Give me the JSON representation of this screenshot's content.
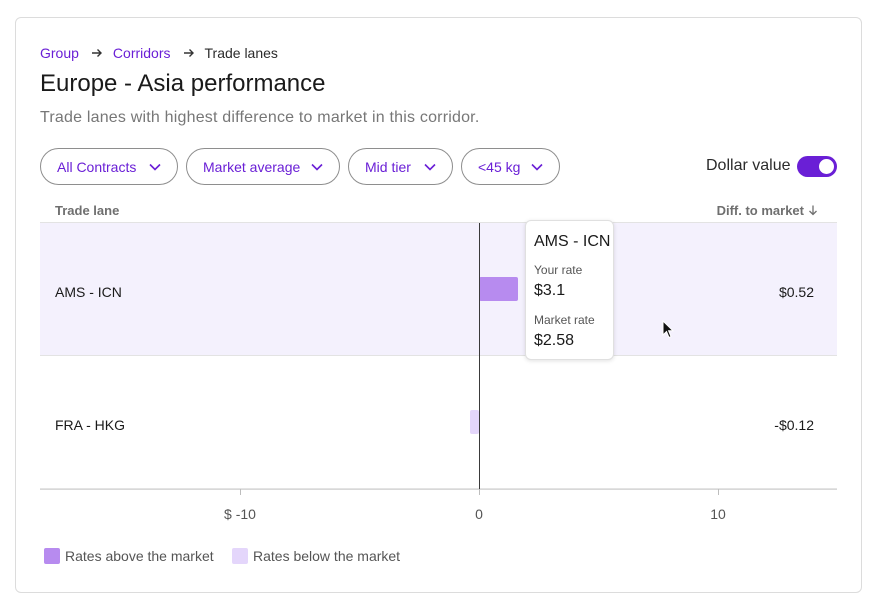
{
  "breadcrumb": {
    "items": [
      "Group",
      "Corridors"
    ],
    "current": "Trade lanes"
  },
  "title": "Europe - Asia performance",
  "subtitle": "Trade lanes with highest difference to market in this corridor.",
  "filters": [
    "All Contracts",
    "Market average",
    "Mid tier",
    "<45 kg"
  ],
  "toggle": {
    "label": "Dollar value",
    "on": true
  },
  "table": {
    "col_lane": "Trade lane",
    "col_diff": "Diff. to market",
    "rows": [
      {
        "lane": "AMS - ICN",
        "diff": "$0.52",
        "value": 0.52
      },
      {
        "lane": "FRA - HKG",
        "diff": "-$0.12",
        "value": -0.12
      }
    ]
  },
  "axis": {
    "ticks": [
      "$ -10",
      "0",
      "10"
    ]
  },
  "legend": {
    "above": "Rates above the market",
    "below": "Rates below the market"
  },
  "tooltip": {
    "title": "AMS - ICN",
    "your_rate_label": "Your rate",
    "your_rate": "$3.1",
    "market_rate_label": "Market rate",
    "market_rate": "$2.58"
  },
  "colors": {
    "accent": "#6a1fd6",
    "above": "#b78bef",
    "below": "#e4d6fb",
    "row_highlight": "#f4f1fd"
  },
  "icons": [
    "arrow-right-icon",
    "chevron-down-icon",
    "arrow-down-icon",
    "cursor-icon"
  ]
}
